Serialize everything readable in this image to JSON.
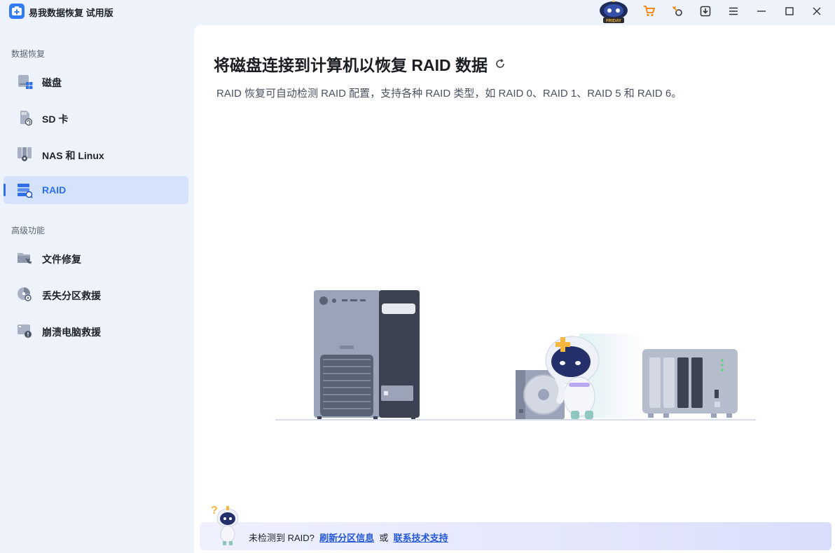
{
  "app": {
    "title": "易我数据恢复 试用版",
    "mascot_badge": "FRIDAY"
  },
  "titlebar": {
    "icons": [
      "cart-icon",
      "key-icon",
      "download-icon",
      "menu-icon",
      "minimize-icon",
      "maximize-icon",
      "close-icon"
    ]
  },
  "sidebar": {
    "section_recovery": "数据恢复",
    "section_advanced": "高级功能",
    "recovery_items": [
      {
        "label": "磁盘",
        "icon": "disk-icon"
      },
      {
        "label": "SD 卡",
        "icon": "sd-card-icon"
      },
      {
        "label": "NAS 和 Linux",
        "icon": "nas-icon"
      },
      {
        "label": "RAID",
        "icon": "raid-icon",
        "active": true
      }
    ],
    "advanced_items": [
      {
        "label": "文件修复",
        "icon": "file-repair-icon"
      },
      {
        "label": "丢失分区救援",
        "icon": "partition-rescue-icon"
      },
      {
        "label": "崩溃电脑救援",
        "icon": "crash-pc-rescue-icon"
      }
    ]
  },
  "main": {
    "title": "将磁盘连接到计算机以恢复 RAID 数据",
    "description": "RAID 恢复可自动检测 RAID 配置，支持各种 RAID 类型，如 RAID 0、RAID 1、RAID 5 和 RAID 6。"
  },
  "footer": {
    "prefix": "未检测到 RAID?",
    "link_refresh": "刷新分区信息",
    "or": "或",
    "link_support": "联系技术支持"
  },
  "colors": {
    "accent": "#2f6fe8",
    "sidebar_bg": "#eef3fb",
    "active_bg": "#d4e2fb",
    "link": "#2457d6"
  }
}
